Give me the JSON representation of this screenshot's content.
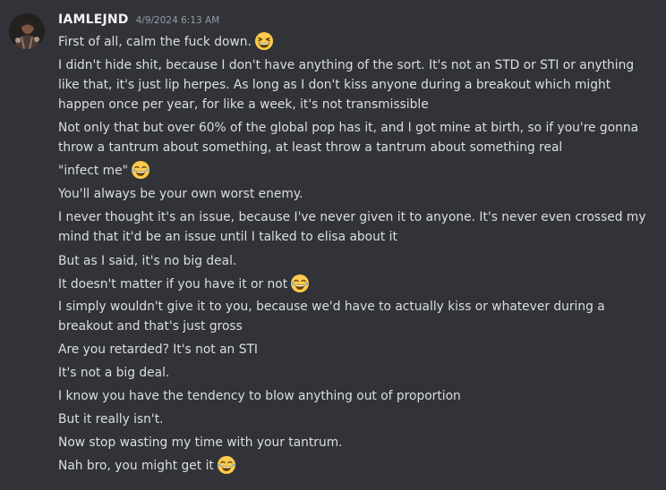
{
  "author": {
    "name": "IAMLEJND",
    "timestamp": "4/9/2024 6:13 AM"
  },
  "messages": [
    {
      "text": "First of all, calm the fuck down.",
      "emoji": "grinning-squinting-face"
    },
    {
      "text": "I didn't hide shit, because I don't have anything of the sort. It's not an STD or STI or anything"
    },
    {
      "text": "like that, it's just lip herpes. As long as I don't kiss anyone during a breakout which might"
    },
    {
      "text": "happen once per year, for like a week, it's not transmissible"
    },
    {
      "text": "Not only that but over 60% of the global pop has it, and I got mine at birth, so if you're gonna"
    },
    {
      "text": "throw a tantrum about something, at least throw a tantrum about something real"
    },
    {
      "text": "\"infect me\"",
      "emoji": "face-with-tears-of-joy"
    },
    {
      "text": "You'll always be your own worst enemy."
    },
    {
      "text": "I never thought it's an issue, because I've never given it to anyone. It's never even crossed my"
    },
    {
      "text": "mind that it'd be an issue until I talked to elisa about it"
    },
    {
      "text": "But as I said, it's no big deal."
    },
    {
      "text": "It doesn't matter if you have it or not",
      "emoji": "face-with-tears-of-joy"
    },
    {
      "text": "I simply wouldn't give it to you, because we'd have to actually kiss or whatever during a"
    },
    {
      "text": "breakout and that's just gross"
    },
    {
      "text": "Are you retarded? It's not an STI"
    },
    {
      "text": "It's not a big deal."
    },
    {
      "text": "I know you have the tendency to blow anything out of proportion"
    },
    {
      "text": "But it really isn't."
    },
    {
      "text": "Now stop wasting my time with your tantrum."
    },
    {
      "text": "Nah bro, you might get it",
      "emoji": "face-with-tears-of-joy"
    }
  ]
}
